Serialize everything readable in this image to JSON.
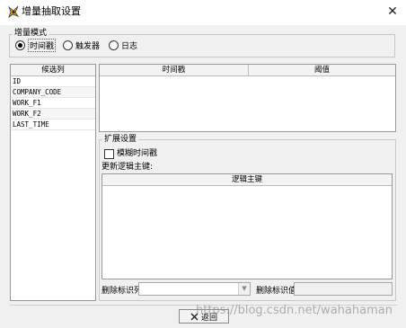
{
  "window": {
    "title": "增量抽取设置",
    "close_glyph": "✕",
    "app_icon": "app-icon"
  },
  "mode": {
    "legend": "增量模式",
    "options": [
      {
        "label": "时间戳",
        "checked": true
      },
      {
        "label": "触发器",
        "checked": false
      },
      {
        "label": "日志",
        "checked": false
      }
    ]
  },
  "candidates": {
    "header": "候选列",
    "items": [
      "ID",
      "COMPANY_CODE",
      "WORK_F1",
      "WORK_F2",
      "LAST_TIME"
    ]
  },
  "timestamp_table": {
    "columns": [
      "时间戳",
      "阈值"
    ]
  },
  "extended": {
    "legend": "扩展设置",
    "fuzzy_label": "模糊时间戳",
    "fuzzy_checked": false,
    "update_key_label": "更新逻辑主键:",
    "logic_key_header": "逻辑主键",
    "delete_flag_col_label": "删除标识列",
    "delete_flag_col_value": "",
    "delete_flag_val_label": "删除标识值",
    "delete_flag_val_value": ""
  },
  "footer": {
    "back_label": "返回",
    "back_icon": "close-x-icon"
  },
  "watermark": "https://blog.csdn.net/wahahaman"
}
